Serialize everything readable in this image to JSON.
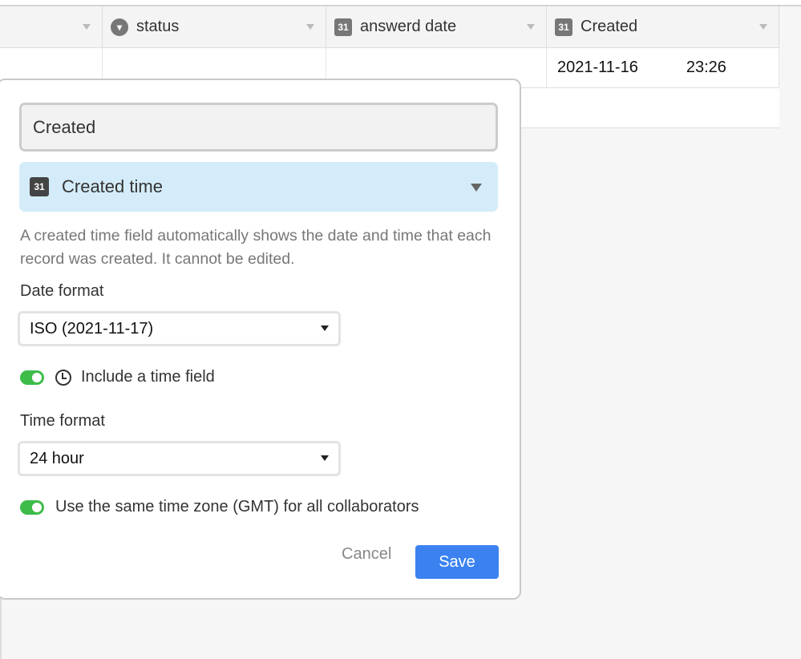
{
  "table": {
    "columns": [
      {
        "label": "",
        "icon": ""
      },
      {
        "label": "status",
        "icon": "single-select-icon"
      },
      {
        "label": "answerd date",
        "icon": "calendar-icon"
      },
      {
        "label": "Created",
        "icon": "created-time-icon"
      }
    ],
    "rows": [
      {
        "created_date": "2021-11-16",
        "created_time": "23:26"
      }
    ]
  },
  "icons": {
    "calendar_text": "31"
  },
  "dialog": {
    "field_name": "Created",
    "field_type": "Created time",
    "description": "A created time field automatically shows the date and time that each record was created. It cannot be edited.",
    "date_format_label": "Date format",
    "date_format_value": "ISO (2021-11-17)",
    "include_time_label": "Include a time field",
    "include_time_on": true,
    "time_format_label": "Time format",
    "time_format_value": "24 hour",
    "same_tz_label": "Use the same time zone (GMT) for all collaborators",
    "same_tz_on": true,
    "cancel_label": "Cancel",
    "save_label": "Save"
  },
  "colors": {
    "accent": "#3b82f0",
    "toggle_on": "#3dbc4a",
    "type_bg": "#d4ecf9"
  }
}
